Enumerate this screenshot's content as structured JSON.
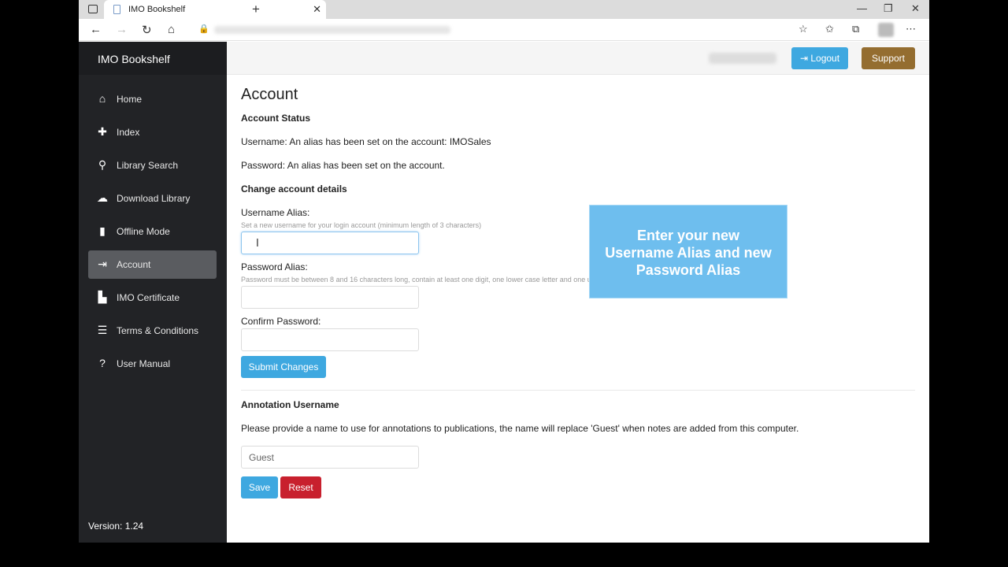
{
  "browser": {
    "tab_title": "IMO Bookshelf",
    "tab_close": "✕",
    "new_tab": "+",
    "window_controls": {
      "minimize": "—",
      "restore": "❐",
      "close": "✕"
    }
  },
  "app": {
    "brand": "IMO Bookshelf",
    "version": "Version: 1.24",
    "nav": [
      {
        "label": "Home",
        "icon": "home-icon",
        "glyph": "⌂"
      },
      {
        "label": "Index",
        "icon": "plus-icon",
        "glyph": "✚"
      },
      {
        "label": "Library Search",
        "icon": "search-icon",
        "glyph": "⚲"
      },
      {
        "label": "Download Library",
        "icon": "cloud-download-icon",
        "glyph": "☁"
      },
      {
        "label": "Offline Mode",
        "icon": "signal-icon",
        "glyph": "▮"
      },
      {
        "label": "Account",
        "icon": "sign-in-icon",
        "glyph": "⇥",
        "active": true
      },
      {
        "label": "IMO Certificate",
        "icon": "book-icon",
        "glyph": "▙"
      },
      {
        "label": "Terms & Conditions",
        "icon": "list-icon",
        "glyph": "☰"
      },
      {
        "label": "User Manual",
        "icon": "question-icon",
        "glyph": "?"
      }
    ]
  },
  "header": {
    "logout_label": "⇥ Logout",
    "support_label": "Support"
  },
  "account": {
    "title": "Account",
    "status_heading": "Account Status",
    "username_status": "Username: An alias has been set on the account: IMOSales",
    "password_status": "Password: An alias has been set on the account.",
    "change_heading": "Change account details",
    "username_alias_label": "Username Alias:",
    "username_alias_hint": "Set a new username for your login account (minimum length of 3 characters)",
    "username_alias_value": "",
    "password_alias_label": "Password Alias:",
    "password_alias_hint": "Password must be between 8 and 16 characters long, contain at least one digit, one lower case letter and one upper case letter.",
    "confirm_password_label": "Confirm Password:",
    "submit_label": "Submit Changes",
    "annotation_heading": "Annotation Username",
    "annotation_text": "Please provide a name to use for annotations to publications, the name will replace 'Guest' when notes are added from this computer.",
    "annotation_value": "Guest",
    "save_label": "Save",
    "reset_label": "Reset"
  },
  "callout": {
    "text": "Enter your new Username Alias and new Password Alias"
  },
  "colors": {
    "sidebar": "#222326",
    "primary": "#3ea8e0",
    "support": "#946d30",
    "danger": "#c8202e",
    "callout": "#6ebeee"
  }
}
